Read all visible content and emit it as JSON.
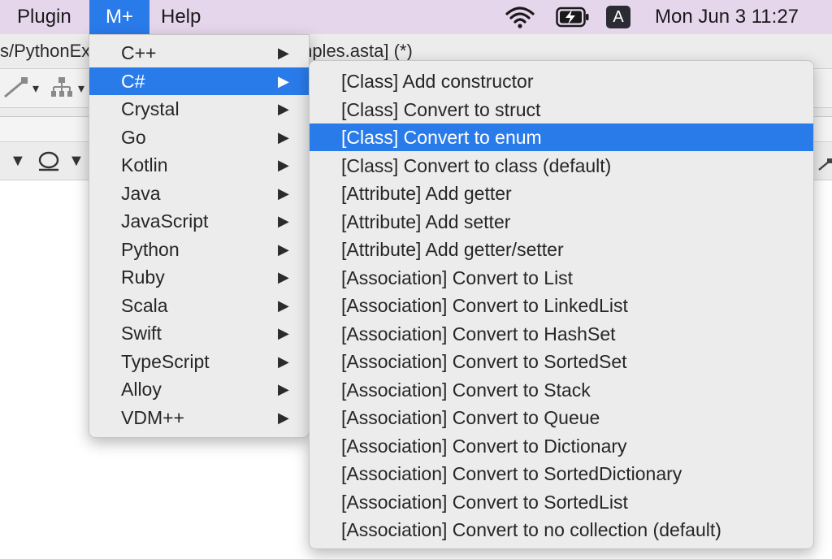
{
  "menubar": {
    "items": [
      "Plugin",
      "M+",
      "Help"
    ],
    "clock": "Mon Jun 3  11:27",
    "input_source": "A"
  },
  "window": {
    "title_left": "s/PythonEx",
    "title_right": "mples.asta] (*)"
  },
  "language_menu": {
    "items": [
      {
        "label": "C++"
      },
      {
        "label": "C#",
        "active": true
      },
      {
        "label": "Crystal"
      },
      {
        "label": "Go"
      },
      {
        "label": "Kotlin"
      },
      {
        "label": "Java"
      },
      {
        "label": "JavaScript"
      },
      {
        "label": "Python"
      },
      {
        "label": "Ruby"
      },
      {
        "label": "Scala"
      },
      {
        "label": "Swift"
      },
      {
        "label": "TypeScript"
      },
      {
        "label": "Alloy"
      },
      {
        "label": "VDM++"
      }
    ],
    "arrow": "▶"
  },
  "csharp_submenu": {
    "items": [
      {
        "label": "[Class] Add constructor"
      },
      {
        "label": "[Class] Convert to struct"
      },
      {
        "label": "[Class] Convert to enum",
        "active": true
      },
      {
        "label": "[Class] Convert to class (default)"
      },
      {
        "label": "[Attribute] Add getter"
      },
      {
        "label": "[Attribute] Add setter"
      },
      {
        "label": "[Attribute] Add getter/setter"
      },
      {
        "label": "[Association] Convert to List"
      },
      {
        "label": "[Association] Convert to LinkedList"
      },
      {
        "label": "[Association] Convert to HashSet"
      },
      {
        "label": "[Association] Convert to SortedSet"
      },
      {
        "label": "[Association] Convert to Stack"
      },
      {
        "label": "[Association] Convert to Queue"
      },
      {
        "label": "[Association] Convert to Dictionary"
      },
      {
        "label": "[Association] Convert to SortedDictionary"
      },
      {
        "label": "[Association] Convert to SortedList"
      },
      {
        "label": "[Association] Convert to no collection (default)"
      }
    ]
  },
  "colors": {
    "menubar_bg": "#e6d6ec",
    "highlight": "#2a7bea",
    "menu_bg": "#ececec"
  },
  "icons": [
    "wifi-icon",
    "battery-charging-icon",
    "input-source-icon",
    "submenu-arrow-icon",
    "connector-tool-icon",
    "tree-layout-icon",
    "lasso-tool-icon"
  ]
}
